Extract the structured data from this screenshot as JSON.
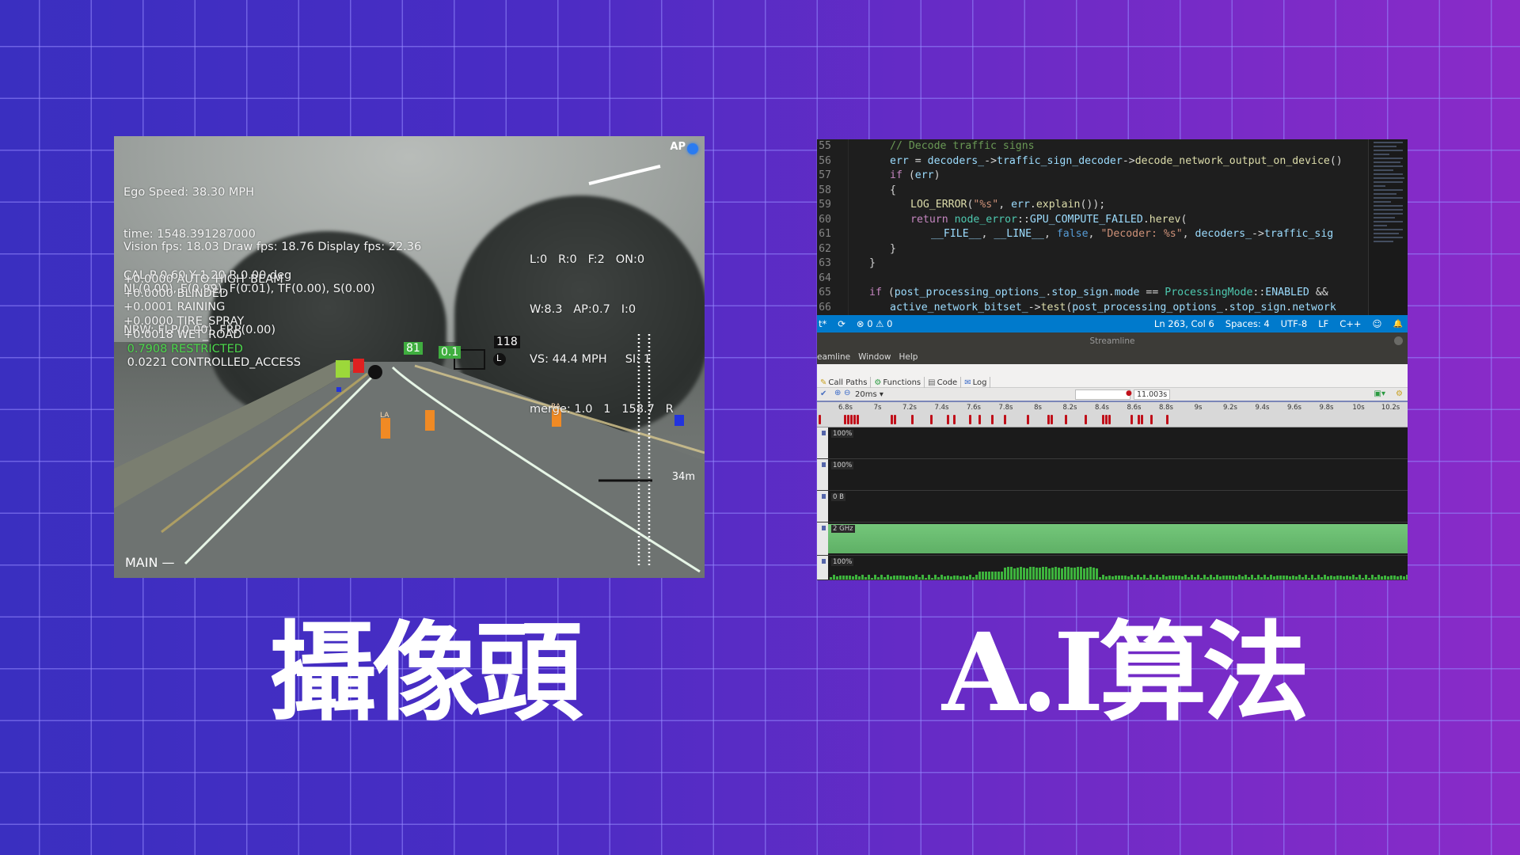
{
  "camera": {
    "hud_top_left": [
      "Ego Speed: 38.30 MPH",
      "time: 1548.391287000",
      "CAL P 0.60 Y 1.20 R 0.00 deg"
    ],
    "hud_fps": [
      "Vision fps: 18.03 Draw fps: 18.76 Display fps: 22.36",
      "NL(0.00), E(0.99), F(0.01), TF(0.00), S(0.00)",
      "NRW: FLP(0.00), FRP(0.00)"
    ],
    "hud_classes": [
      {
        "text": "+0.0000 AUTO_HIGH_BEAM",
        "highlight": false
      },
      {
        "text": "+0.0000 BLINDED",
        "highlight": false
      },
      {
        "text": "+0.0001 RAINING",
        "highlight": false
      },
      {
        "text": "+0.0000 TIRE_SPRAY",
        "highlight": false
      },
      {
        "text": "+0.0018 WET_ROAD",
        "highlight": false
      },
      {
        "text": " 0.7908 RESTRICTED",
        "highlight": true
      },
      {
        "text": " 0.0221 CONTROLLED_ACCESS",
        "highlight": false
      }
    ],
    "hud_right": [
      "L:0   R:0   F:2   ON:0",
      "W:8.3   AP:0.7   I:0",
      "VS: 44.4 MPH     SI: 1",
      "merge: 1.0   1   158.7   R"
    ],
    "ap_label": "AP",
    "mode_label": "MAIN  —",
    "distance_label": "34m",
    "detections": [
      {
        "label": "81",
        "color": "#3fae3f"
      },
      {
        "label": "0.1",
        "color": "#3fae3f"
      },
      {
        "label": "118",
        "color": "#111111"
      },
      {
        "label": "L",
        "color": "#111111"
      }
    ],
    "cone_labels": [
      "LA",
      "RA"
    ],
    "colors": {
      "lane_line": "#e6f5e6",
      "highlight": "#4cd84c",
      "cone": "#f08a24",
      "ap_dot": "#2a7bf0"
    }
  },
  "editor": {
    "lines": [
      {
        "n": "55",
        "indent": 2,
        "tokens": [
          [
            "c-com",
            "// Decode traffic signs"
          ]
        ]
      },
      {
        "n": "56",
        "indent": 2,
        "tokens": [
          [
            "c-var",
            "err"
          ],
          [
            "",
            " = "
          ],
          [
            "c-var",
            "decoders_"
          ],
          [
            "",
            "->"
          ],
          [
            "c-var",
            "traffic_sign_decoder"
          ],
          [
            "",
            "->"
          ],
          [
            "c-fn",
            "decode_network_output_on_device"
          ],
          [
            "",
            "()"
          ]
        ]
      },
      {
        "n": "57",
        "indent": 2,
        "tokens": [
          [
            "c-kw",
            "if"
          ],
          [
            "",
            " ("
          ],
          [
            "c-var",
            "err"
          ],
          [
            "",
            ")"
          ]
        ]
      },
      {
        "n": "58",
        "indent": 2,
        "tokens": [
          [
            "",
            "{"
          ]
        ]
      },
      {
        "n": "59",
        "indent": 3,
        "tokens": [
          [
            "c-fn",
            "LOG_ERROR"
          ],
          [
            "",
            "("
          ],
          [
            "c-str",
            "\"%s\""
          ],
          [
            "",
            ", "
          ],
          [
            "c-var",
            "err"
          ],
          [
            "",
            "."
          ],
          [
            "c-fn",
            "explain"
          ],
          [
            "",
            "());"
          ]
        ]
      },
      {
        "n": "60",
        "indent": 3,
        "tokens": [
          [
            "c-kw",
            "return"
          ],
          [
            "",
            " "
          ],
          [
            "c-type",
            "node_error"
          ],
          [
            "",
            "::"
          ],
          [
            "c-var",
            "GPU_COMPUTE_FAILED"
          ],
          [
            "",
            "."
          ],
          [
            "c-fn",
            "herev"
          ],
          [
            "",
            "("
          ]
        ]
      },
      {
        "n": "61",
        "indent": 4,
        "tokens": [
          [
            "c-var",
            "__FILE__"
          ],
          [
            "",
            ", "
          ],
          [
            "c-var",
            "__LINE__"
          ],
          [
            "",
            ", "
          ],
          [
            "c-bool",
            "false"
          ],
          [
            "",
            ", "
          ],
          [
            "c-str",
            "\"Decoder: %s\""
          ],
          [
            "",
            ", "
          ],
          [
            "c-var",
            "decoders_"
          ],
          [
            "",
            "->"
          ],
          [
            "c-var",
            "traffic_sig"
          ]
        ]
      },
      {
        "n": "62",
        "indent": 2,
        "tokens": [
          [
            "",
            "}"
          ]
        ]
      },
      {
        "n": "63",
        "indent": 1,
        "tokens": [
          [
            "",
            "}"
          ]
        ]
      },
      {
        "n": "64",
        "indent": 0,
        "tokens": []
      },
      {
        "n": "65",
        "indent": 1,
        "tokens": [
          [
            "c-kw",
            "if"
          ],
          [
            "",
            " ("
          ],
          [
            "c-var",
            "post_processing_options_"
          ],
          [
            "",
            "."
          ],
          [
            "c-var",
            "stop_sign"
          ],
          [
            "",
            "."
          ],
          [
            "c-var",
            "mode"
          ],
          [
            "",
            " == "
          ],
          [
            "c-type",
            "ProcessingMode"
          ],
          [
            "",
            "::"
          ],
          [
            "c-var",
            "ENABLED"
          ],
          [
            "",
            " &&"
          ]
        ]
      },
      {
        "n": "66",
        "indent": 2,
        "tokens": [
          [
            "c-var",
            "active_network_bitset_"
          ],
          [
            "",
            "->"
          ],
          [
            "c-fn",
            "test"
          ],
          [
            "",
            "("
          ],
          [
            "c-var",
            "post_processing_options_"
          ],
          [
            "",
            "."
          ],
          [
            "c-var",
            "stop_sign"
          ],
          [
            "",
            "."
          ],
          [
            "c-var",
            "network"
          ]
        ]
      }
    ],
    "status": {
      "branch_suffix": "t*",
      "sync_icon": "⟳",
      "errors": "⊗ 0",
      "warnings": "⚠ 0",
      "position": "Ln 263, Col 6",
      "spaces": "Spaces: 4",
      "encoding": "UTF-8",
      "eol": "LF",
      "language": "C++",
      "feedback_icon": "☺",
      "bell_icon": "🔔"
    }
  },
  "streamline": {
    "window_title": "Streamline",
    "menu": [
      "eamline",
      "Window",
      "Help"
    ],
    "tabs": [
      {
        "icon": "✎",
        "label": "Call Paths"
      },
      {
        "icon": "⚙",
        "label": "Functions"
      },
      {
        "icon": "▤",
        "label": "Code"
      },
      {
        "icon": "✉",
        "label": "Log"
      }
    ],
    "zoom_value": "20ms",
    "time_value": "11.003s",
    "ruler_ticks": [
      "6.8s",
      "7s",
      "7.2s",
      "7.4s",
      "7.6s",
      "7.8s",
      "8s",
      "8.2s",
      "8.4s",
      "8.6s",
      "8.8s",
      "9s",
      "9.2s",
      "9.4s",
      "9.6s",
      "9.8s",
      "10s",
      "10.2s"
    ],
    "marker_times": [
      6.63,
      6.79,
      6.81,
      6.83,
      6.85,
      6.87,
      7.08,
      7.1,
      7.21,
      7.33,
      7.43,
      7.47,
      7.57,
      7.63,
      7.71,
      7.79,
      7.93,
      8.06,
      8.08,
      8.17,
      8.29,
      8.4,
      8.42,
      8.44,
      8.58,
      8.62,
      8.64,
      8.7,
      8.8
    ],
    "tracks": [
      {
        "label": "100%",
        "type": "empty"
      },
      {
        "label": "100%",
        "type": "empty"
      },
      {
        "label": "0 B",
        "type": "empty"
      },
      {
        "label": "2 GHz",
        "type": "frequency"
      },
      {
        "label": "100%",
        "type": "activity"
      }
    ],
    "colors": {
      "marker": "#c0101a",
      "freq": "#6cc072",
      "activity": "#3db33d"
    }
  },
  "titles": {
    "left": "攝像頭",
    "right": "A.I算法"
  }
}
